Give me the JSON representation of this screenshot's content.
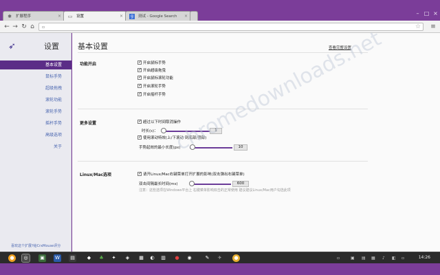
{
  "tabs": [
    {
      "label": "扩展程序",
      "icon": "puzzle-icon",
      "active": false
    },
    {
      "label": "设置",
      "icon": "document-icon",
      "active": true
    },
    {
      "label": "测试 - Google Search",
      "icon": "google-icon",
      "active": false
    }
  ],
  "toolbar": {
    "url": ""
  },
  "sidebar": {
    "title": "设置",
    "items": [
      {
        "label": "基本设置",
        "active": true
      },
      {
        "label": "鼠标手势",
        "active": false
      },
      {
        "label": "超级拖拽",
        "active": false
      },
      {
        "label": "滚轮功能",
        "active": false
      },
      {
        "label": "滚轮手势",
        "active": false
      },
      {
        "label": "摇杆手势",
        "active": false
      },
      {
        "label": "高级选项",
        "active": false
      },
      {
        "label": "关于",
        "active": false
      }
    ],
    "footer": "喜欢这个扩展?给CrxMouse评分"
  },
  "main": {
    "title": "基本设置",
    "help_link": "查看完整设置",
    "sections": {
      "features": {
        "label": "功能开启",
        "options": [
          {
            "label": "开启鼠标手势",
            "checked": true
          },
          {
            "label": "开启超级拖曳",
            "checked": true
          },
          {
            "label": "开启鼠标滚轮功能",
            "checked": true
          },
          {
            "label": "开启滚轮手势",
            "checked": true
          },
          {
            "label": "开启摇杆手势",
            "checked": true
          }
        ]
      },
      "more": {
        "label": "更多设置",
        "option1": {
          "label": "超过以下时间取消操作",
          "checked": true
        },
        "timeout": {
          "label": "时长(s)：",
          "value": "1"
        },
        "option2": {
          "label": "使用滚动特效(上/下滚动 到底部/顶部)",
          "checked": true
        },
        "min_length": {
          "label": "手势起效的最小长度(px)",
          "value": "10"
        }
      },
      "linux": {
        "label": "Linux/Mac选项",
        "option1": {
          "label": "请开Linux/Mac右键菜单打开扩展的影响(双击弹出右键菜单)",
          "checked": true
        },
        "double_click": {
          "label": "双击间隔最长时间(ms)",
          "value": "600"
        },
        "hint": "注意：这些选项在Windows平台上 右键菜单影响双击的正常使用 建议建议Linux/Mac用户勾选此项"
      }
    }
  },
  "watermark": "chromedownloads.net",
  "taskbar": {
    "clock": "14:26"
  },
  "colors": {
    "frame": "#7b3d99",
    "sidebar_active": "#5b2d87",
    "link": "#4a66b0",
    "slider": "#6a3a98"
  }
}
